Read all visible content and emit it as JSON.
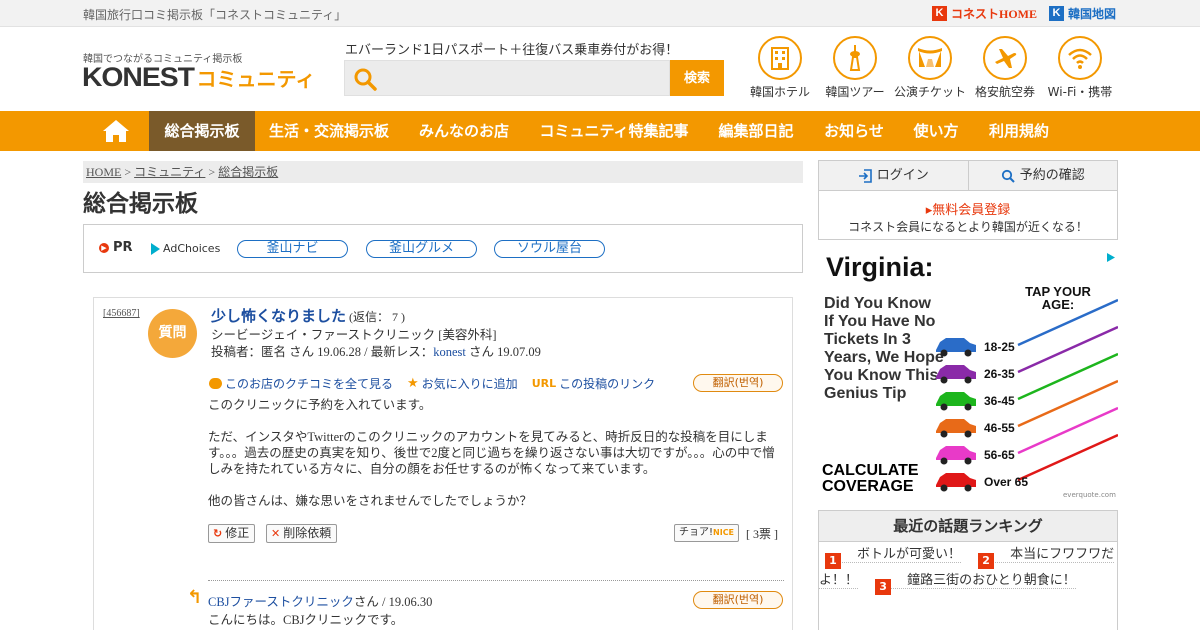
{
  "topbar": {
    "site_desc": "韓国旅行口コミ掲示板「コネストコミュニティ」",
    "konest_home": "コネストHOME",
    "korea_map": "韓国地図"
  },
  "header": {
    "logo_sub": "韓国でつながるコミュニティ掲示板",
    "logo_main": "KONEST",
    "logo_comm": "コミュニティ",
    "promo": "エバーランド1日パスポート＋往復バス乗車券付がお得！",
    "search_placeholder": "",
    "search_button": "検索",
    "services": [
      {
        "label": "韓国ホテル",
        "icon": "hotel-icon"
      },
      {
        "label": "韓国ツアー",
        "icon": "tower-icon"
      },
      {
        "label": "公演チケット",
        "icon": "theater-icon"
      },
      {
        "label": "格安航空券",
        "icon": "airplane-icon"
      },
      {
        "label": "Wi-Fi・携帯",
        "icon": "wifi-icon"
      }
    ]
  },
  "nav": {
    "items": [
      "総合掲示板",
      "生活・交流掲示板",
      "みんなのお店",
      "コミュニティ特集記事",
      "編集部日記",
      "お知らせ",
      "使い方",
      "利用規約"
    ],
    "active_index": 0
  },
  "breadcrumb": [
    "HOME",
    "コミュニティ",
    "総合掲示板"
  ],
  "page_title": "総合掲示板",
  "pr": {
    "label": "PR",
    "adchoices": "AdChoices",
    "links": [
      "釜山ナビ",
      "釜山グルメ",
      "ソウル屋台"
    ]
  },
  "post": {
    "id": "[456687]",
    "badge": "質問",
    "title": "少し怖くなりました",
    "replies": "(返信： 7 )",
    "clinic": "シービージェイ・ファーストクリニック [美容外科]",
    "meta_prefix": "投稿者：匿名 さん 19.06.28 / 最新レス：",
    "meta_user": "konest",
    "meta_suffix": " さん 19.07.09",
    "actions": {
      "reviews": "このお店のクチコミを全て見る",
      "favorite": "お気に入りに追加",
      "url_tag": "URL",
      "post_link": "この投稿のリンク",
      "translate": "翻訳(번역)"
    },
    "body": [
      "このクリニックに予約を入れています。",
      "ただ、インスタやTwitterのこのクリニックのアカウントを見てみると、時折反日的な投稿を目にします。。。過去の歴史の真実を知り、後世で2度と同じ過ちを繰り返さない事は大切ですが。。。心の中で憎しみを持たれている方々に、自分の顔をお任せするのが怖くなって来ています。",
      "他の皆さんは、嫌な思いをされませんでしたでしょうか？"
    ],
    "edit": "修正",
    "delete_request": "削除依頼",
    "nice": "チョア!",
    "nice_tag": "NICE",
    "votes": "[ 3票 ]",
    "reply": {
      "author": "CBJファーストクリニック",
      "meta": "さん / 19.06.30",
      "text": "こんにちは。CBJクリニックです。",
      "translate": "翻訳(번역)"
    }
  },
  "sidebar": {
    "login": "ログイン",
    "reservation": "予約の確認",
    "register": "無料会員登録",
    "register_sub": "コネスト会員になるとより韓国が近くなる！",
    "ad": {
      "title": "Virginia:",
      "question": "Did You Know If You Have No Tickets In 3 Years, We Hope You Know This Genius Tip",
      "tap": "TAP YOUR AGE:",
      "ages": [
        "18-25",
        "26-35",
        "36-45",
        "46-55",
        "56-65",
        "Over 65"
      ],
      "age_colors": [
        "#2a6cc8",
        "#8a2aa8",
        "#1db51d",
        "#e86a18",
        "#e83ac8",
        "#e01818"
      ],
      "calc": "CALCULATE COVERAGE",
      "brand": "everquote.com"
    },
    "ranking": {
      "title": "最近の話題ランキング",
      "items": [
        "ボトルが可愛い！",
        "本当にフワフワだよ！！",
        "鐘路三街のおひとり朝食に！"
      ]
    }
  },
  "colors": {
    "accent": "#f39800",
    "nav_active": "#7a5a2a",
    "link": "#1d4fa0",
    "red": "#e8380d"
  }
}
